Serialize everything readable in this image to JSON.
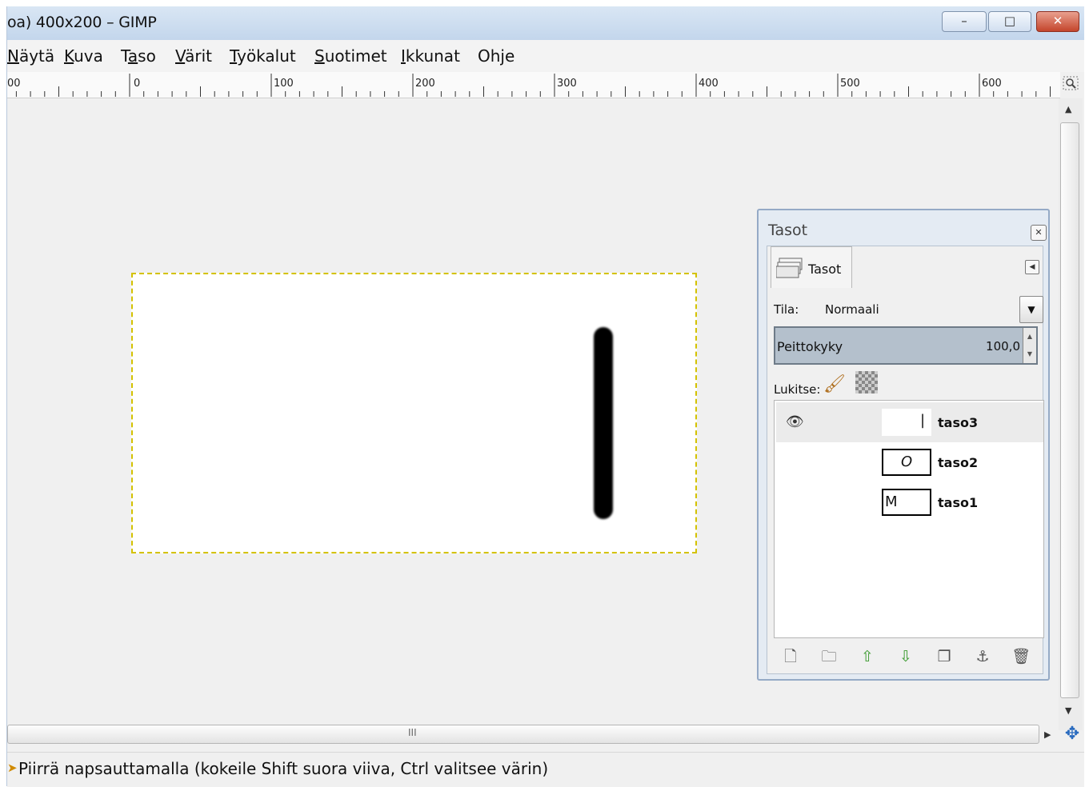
{
  "window": {
    "title": "oa) 400x200 – GIMP",
    "buttons": {
      "minimize": "–",
      "maximize": "□",
      "close": "✕"
    }
  },
  "menubar": [
    {
      "pre": "",
      "ul": "N",
      "post": "äytä"
    },
    {
      "pre": "",
      "ul": "K",
      "post": "uva"
    },
    {
      "pre": "T",
      "ul": "a",
      "post": "so"
    },
    {
      "pre": "",
      "ul": "V",
      "post": "ärit"
    },
    {
      "pre": "",
      "ul": "T",
      "post": "yökalut"
    },
    {
      "pre": "",
      "ul": "S",
      "post": "uotimet"
    },
    {
      "pre": "",
      "ul": "I",
      "post": "kkunat"
    },
    {
      "pre": "Oh",
      "ul": "j",
      "post": "e"
    }
  ],
  "ruler": {
    "labels": [
      "00",
      "0",
      "100",
      "200",
      "300",
      "400",
      "500",
      "600"
    ]
  },
  "statusbar": {
    "text": "Piirrä napsauttamalla (kokeile Shift suora viiva, Ctrl valitsee värin)"
  },
  "layers_dock": {
    "title": "Tasot",
    "tab_label": "Tasot",
    "mode_label": "Tila:",
    "mode_value": "Normaali",
    "opacity_label": "Peittokyky",
    "opacity_value": "100,0",
    "lock_label": "Lukitse:",
    "layers": [
      {
        "name": "taso3",
        "thumb": "|",
        "visible": true,
        "selected": true
      },
      {
        "name": "taso2",
        "thumb": "O",
        "visible": false,
        "selected": false
      },
      {
        "name": "taso1",
        "thumb": "M",
        "visible": false,
        "selected": false
      }
    ],
    "buttons": [
      "new-layer-icon",
      "new-group-icon",
      "raise-layer-icon",
      "lower-layer-icon",
      "duplicate-layer-icon",
      "anchor-layer-icon",
      "delete-layer-icon"
    ]
  },
  "scroll": {
    "grip": "III"
  }
}
